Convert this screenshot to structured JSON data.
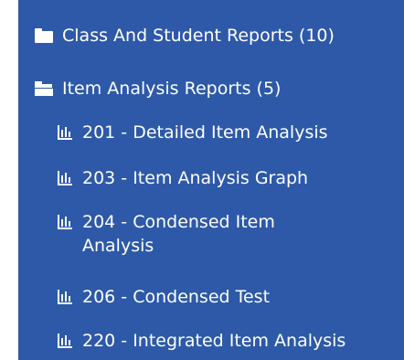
{
  "tree": {
    "folders": [
      {
        "label": "Class And Student Reports (10)",
        "icon": "folder-icon",
        "expanded": false
      },
      {
        "label": "Item Analysis Reports (5)",
        "icon": "folder-open-icon",
        "expanded": true
      }
    ],
    "reports": [
      {
        "label": "201 - Detailed Item Analysis",
        "icon": "bar-chart-icon"
      },
      {
        "label": "203 - Item Analysis Graph",
        "icon": "bar-chart-icon"
      },
      {
        "label": "204 - Condensed Item Analysis",
        "icon": "bar-chart-icon"
      },
      {
        "label": "206 - Condensed Test",
        "icon": "bar-chart-icon"
      },
      {
        "label": "220 - Integrated Item Analysis",
        "icon": "bar-chart-icon"
      }
    ]
  },
  "colors": {
    "panel_background": "#2d59a8",
    "text": "#ffffff"
  }
}
